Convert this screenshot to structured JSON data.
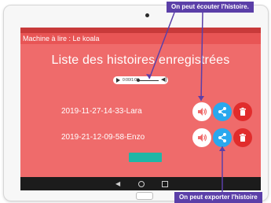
{
  "status_bar": {
    "left": "",
    "right": ""
  },
  "app": {
    "title": "Machine à lire : Le koala"
  },
  "page": {
    "title": "Liste des histoires enregistrées"
  },
  "player": {
    "time": "0:00/1:00"
  },
  "stories": [
    {
      "label": "2019-11-27-14-33-Lara"
    },
    {
      "label": "2019-21-12-09-58-Enzo"
    }
  ],
  "action_button": {
    "label": ""
  },
  "annotations": {
    "top": "On peut écouter l'histoire.",
    "bottom": "On peut exporter l'histoire"
  },
  "colors": {
    "screen_bg": "#ef6b6b",
    "listen_button": "#ffffff",
    "share_button": "#2aa8ee",
    "delete_button": "#e12c2c",
    "callout_bg": "#5b3fa8",
    "action_button": "#20b6a6"
  },
  "icons": {
    "listen": "speaker-icon",
    "share": "share-icon",
    "delete": "trash-icon"
  }
}
